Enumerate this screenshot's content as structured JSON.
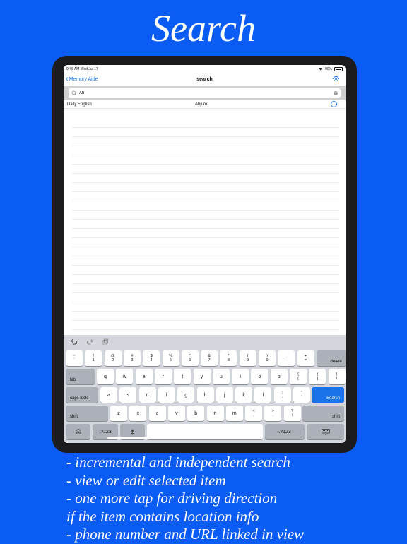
{
  "headline": "Search",
  "status_bar": {
    "time": "9:46 AM",
    "date": "Wed Jul 17",
    "battery": "90%"
  },
  "nav": {
    "back_label": "Memory Aide",
    "title": "search"
  },
  "search": {
    "value": "Ab"
  },
  "results": [
    {
      "category": "Daily English",
      "word": "Abjure"
    }
  ],
  "keyboard": {
    "row1": [
      {
        "top": "~",
        "bottom": "`"
      },
      {
        "top": "!",
        "bottom": "1"
      },
      {
        "top": "@",
        "bottom": "2"
      },
      {
        "top": "#",
        "bottom": "3"
      },
      {
        "top": "$",
        "bottom": "4"
      },
      {
        "top": "%",
        "bottom": "5"
      },
      {
        "top": "^",
        "bottom": "6"
      },
      {
        "top": "&",
        "bottom": "7"
      },
      {
        "top": "*",
        "bottom": "8"
      },
      {
        "top": "(",
        "bottom": "9"
      },
      {
        "top": ")",
        "bottom": "0"
      },
      {
        "top": "_",
        "bottom": "-"
      },
      {
        "top": "+",
        "bottom": "="
      }
    ],
    "delete": "delete",
    "tab": "tab",
    "row2": [
      "q",
      "w",
      "e",
      "r",
      "t",
      "y",
      "u",
      "i",
      "o",
      "p"
    ],
    "row2_brackets": [
      {
        "top": "{",
        "bottom": "["
      },
      {
        "top": "}",
        "bottom": "]"
      },
      {
        "top": "|",
        "bottom": "\\"
      }
    ],
    "caps": "caps lock",
    "row3": [
      "a",
      "s",
      "d",
      "f",
      "g",
      "h",
      "j",
      "k",
      "l"
    ],
    "row3_punct": [
      {
        "top": ":",
        "bottom": ";"
      },
      {
        "top": "\"",
        "bottom": "'"
      }
    ],
    "search_key": "Search",
    "shift": "shift",
    "row4": [
      "z",
      "x",
      "c",
      "v",
      "b",
      "n",
      "m"
    ],
    "row4_punct": [
      {
        "top": "<",
        "bottom": ","
      },
      {
        "top": ">",
        "bottom": "."
      },
      {
        "top": "?",
        "bottom": "/"
      }
    ],
    "numkey": ".?123"
  },
  "bullets": [
    "- incremental and independent search",
    "- view or edit selected item",
    "- one more tap for driving direction",
    "if the item contains location info",
    "- phone number and URL linked in view"
  ],
  "colors": {
    "background": "#0a5cf5",
    "accent": "#1a73e8",
    "keyboard": "#d3d6dc"
  }
}
